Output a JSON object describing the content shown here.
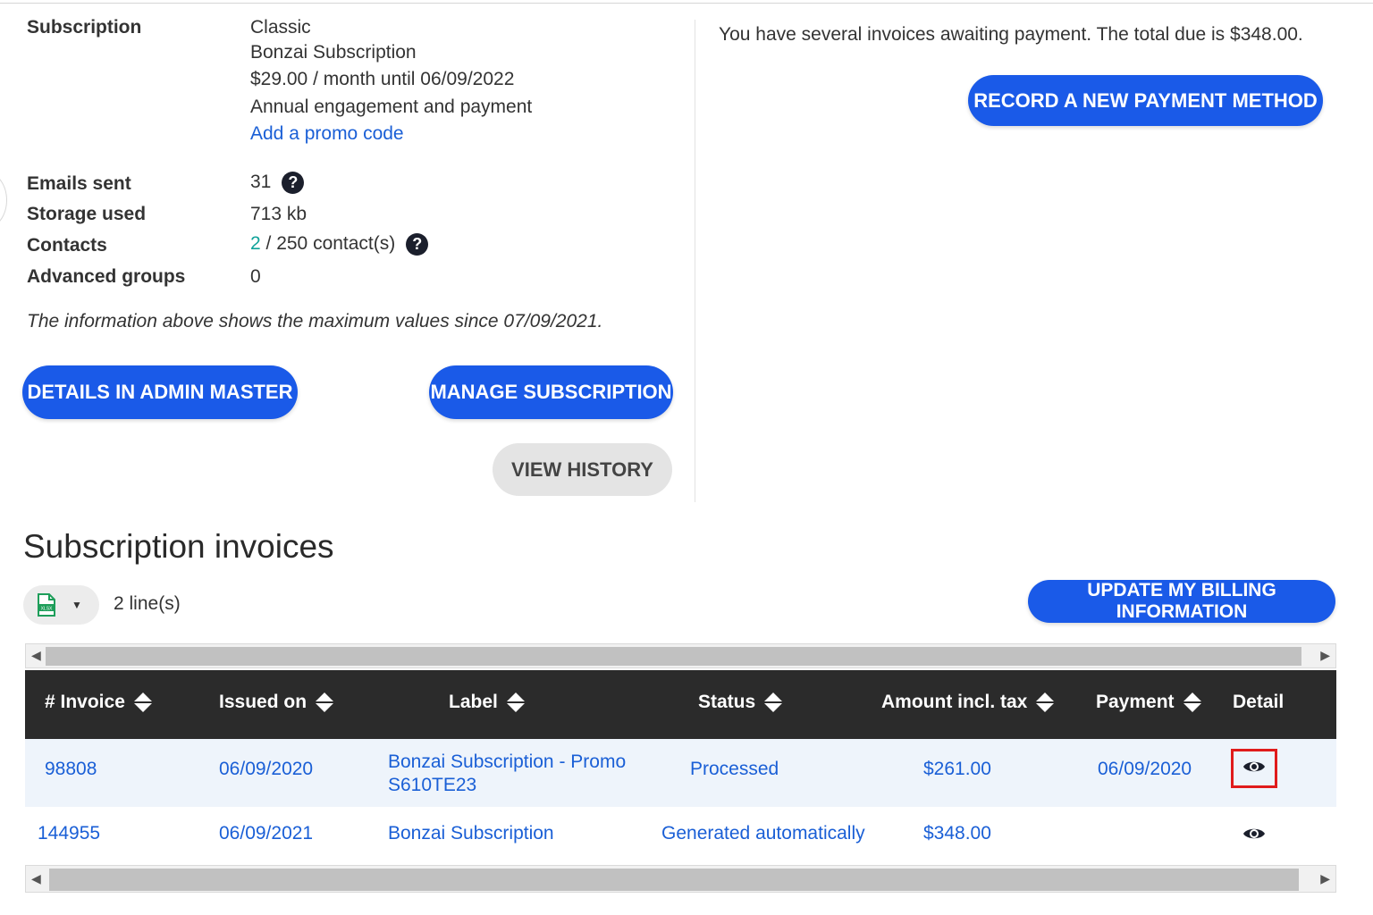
{
  "subscription": {
    "label": "Subscription",
    "plan": "Classic",
    "name": "Bonzai Subscription",
    "price": "$29.00 / month until 06/09/2022",
    "engagement": "Annual engagement and payment",
    "promo_link": "Add a promo code"
  },
  "usage": {
    "emails_label": "Emails sent",
    "emails_value": "31",
    "storage_label": "Storage used",
    "storage_value": "713 kb",
    "contacts_label": "Contacts",
    "contacts_count": "2",
    "contacts_rest": " / 250 contact(s)",
    "groups_label": "Advanced groups",
    "groups_value": "0",
    "help_glyph": "?"
  },
  "note": "The information above shows the maximum values since 07/09/2021.",
  "buttons": {
    "details_admin": "DETAILS IN ADMIN MASTER",
    "manage_subscription": "MANAGE SUBSCRIPTION",
    "view_history": "VIEW HISTORY",
    "record_payment": "RECORD A NEW PAYMENT METHOD",
    "update_billing": "UPDATE MY BILLING INFORMATION"
  },
  "alert": "You have several invoices awaiting payment. The total due is $348.00.",
  "invoices": {
    "title": "Subscription invoices",
    "line_count": "2 line(s)",
    "columns": {
      "invoice": "# Invoice",
      "issued": "Issued on",
      "label": "Label",
      "status": "Status",
      "amount": "Amount incl. tax",
      "payment": "Payment",
      "detail": "Detail"
    },
    "rows": [
      {
        "invoice": "98808",
        "issued": "06/09/2020",
        "label": "Bonzai Subscription - Promo S610TE23",
        "status": "Processed",
        "amount": "$261.00",
        "payment": "06/09/2020",
        "detail_icon": "eye-icon",
        "highlighted": true
      },
      {
        "invoice": "144955",
        "issued": "06/09/2021",
        "label": "Bonzai Subscription",
        "status": "Generated automatically",
        "amount": "$348.00",
        "payment": "",
        "detail_icon": "eye-icon",
        "highlighted": false
      }
    ]
  },
  "icons": {
    "help": "help-circle-icon",
    "export": "xlsx-file-icon",
    "dropdown": "caret-down-icon",
    "sort": "sort-icon",
    "detail": "eye-icon"
  },
  "colors": {
    "primary": "#1a5ae8",
    "link": "#1a5fd6",
    "teal": "#10a39a",
    "table_header": "#2b2b2b",
    "highlight_border": "#e01b1b"
  }
}
